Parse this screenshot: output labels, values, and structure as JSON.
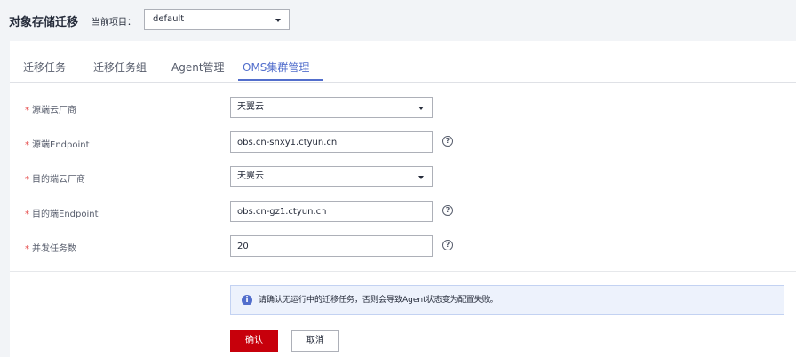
{
  "header": {
    "title": "对象存储迁移",
    "project_label": "当前项目：",
    "project_value": "default"
  },
  "tabs": [
    {
      "label": "迁移任务",
      "active": false
    },
    {
      "label": "迁移任务组",
      "active": false
    },
    {
      "label": "Agent管理",
      "active": false
    },
    {
      "label": "OMS集群管理",
      "active": true
    }
  ],
  "form": {
    "required_mark": "*",
    "help_icon": "?",
    "source_vendor": {
      "label": "源端云厂商",
      "value": "天翼云"
    },
    "source_endpoint": {
      "label": "源端Endpoint",
      "value": "obs.cn-snxy1.ctyun.cn"
    },
    "dest_vendor": {
      "label": "目的端云厂商",
      "value": "天翼云"
    },
    "dest_endpoint": {
      "label": "目的端Endpoint",
      "value": "obs.cn-gz1.ctyun.cn"
    },
    "concurrency": {
      "label": "并发任务数",
      "value": "20"
    }
  },
  "notice": {
    "icon": "i",
    "text": "请确认无运行中的迁移任务，否则会导致Agent状态变为配置失败。"
  },
  "buttons": {
    "confirm": "确认",
    "cancel": "取消"
  },
  "colors": {
    "accent": "#526ecc",
    "primary_button": "#c7000b",
    "required": "#e54545"
  }
}
